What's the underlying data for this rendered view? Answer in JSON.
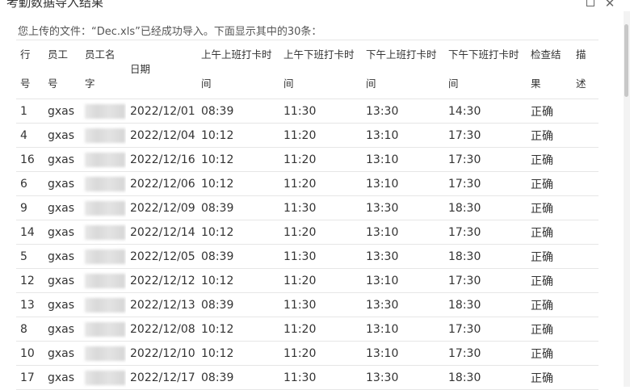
{
  "window": {
    "title": "考勤数据导入结果"
  },
  "info": {
    "text": "您上传的文件：“Dec.xls”已经成功导入。下面显示其中的30条："
  },
  "table": {
    "headers": [
      "行号",
      "员工号",
      "员工名字",
      "日期",
      "上午上班打卡时间",
      "上午下班打卡时间",
      "下午上班打卡时间",
      "下午下班打卡时间",
      "检查结果",
      "描述"
    ],
    "header_lines": [
      [
        "行",
        "号"
      ],
      [
        "员工",
        "号"
      ],
      [
        "员工名",
        "字"
      ],
      [
        "日期"
      ],
      [
        "上午上班打卡时",
        "间"
      ],
      [
        "上午下班打卡时",
        "间"
      ],
      [
        "下午上班打卡时",
        "间"
      ],
      [
        "下午下班打卡时",
        "间"
      ],
      [
        "检查结",
        "果"
      ],
      [
        "描",
        "述"
      ]
    ],
    "rows": [
      [
        "1",
        "gxas",
        "",
        "2022/12/01",
        "08:39",
        "11:30",
        "13:30",
        "14:30",
        "正确",
        ""
      ],
      [
        "4",
        "gxas",
        "",
        "2022/12/04",
        "10:12",
        "11:20",
        "13:10",
        "17:30",
        "正确",
        ""
      ],
      [
        "16",
        "gxas",
        "",
        "2022/12/16",
        "10:12",
        "11:20",
        "13:10",
        "17:30",
        "正确",
        ""
      ],
      [
        "6",
        "gxas",
        "",
        "2022/12/06",
        "10:12",
        "11:20",
        "13:10",
        "17:30",
        "正确",
        ""
      ],
      [
        "9",
        "gxas",
        "",
        "2022/12/09",
        "08:39",
        "11:30",
        "13:30",
        "18:30",
        "正确",
        ""
      ],
      [
        "14",
        "gxas",
        "",
        "2022/12/14",
        "10:12",
        "11:20",
        "13:10",
        "17:30",
        "正确",
        ""
      ],
      [
        "5",
        "gxas",
        "",
        "2022/12/05",
        "08:39",
        "11:30",
        "13:30",
        "18:30",
        "正确",
        ""
      ],
      [
        "12",
        "gxas",
        "",
        "2022/12/12",
        "10:12",
        "11:20",
        "13:10",
        "17:30",
        "正确",
        ""
      ],
      [
        "13",
        "gxas",
        "",
        "2022/12/13",
        "08:39",
        "11:30",
        "13:30",
        "18:30",
        "正确",
        ""
      ],
      [
        "8",
        "gxas",
        "",
        "2022/12/08",
        "10:12",
        "11:20",
        "13:10",
        "17:30",
        "正确",
        ""
      ],
      [
        "10",
        "gxas",
        "",
        "2022/12/10",
        "10:12",
        "11:20",
        "13:10",
        "17:30",
        "正确",
        ""
      ],
      [
        "17",
        "gxas",
        "",
        "2022/12/17",
        "08:39",
        "11:30",
        "13:30",
        "18:30",
        "正确",
        ""
      ]
    ]
  },
  "icons": {
    "maximize": "maximize-icon",
    "close": "close-icon"
  }
}
